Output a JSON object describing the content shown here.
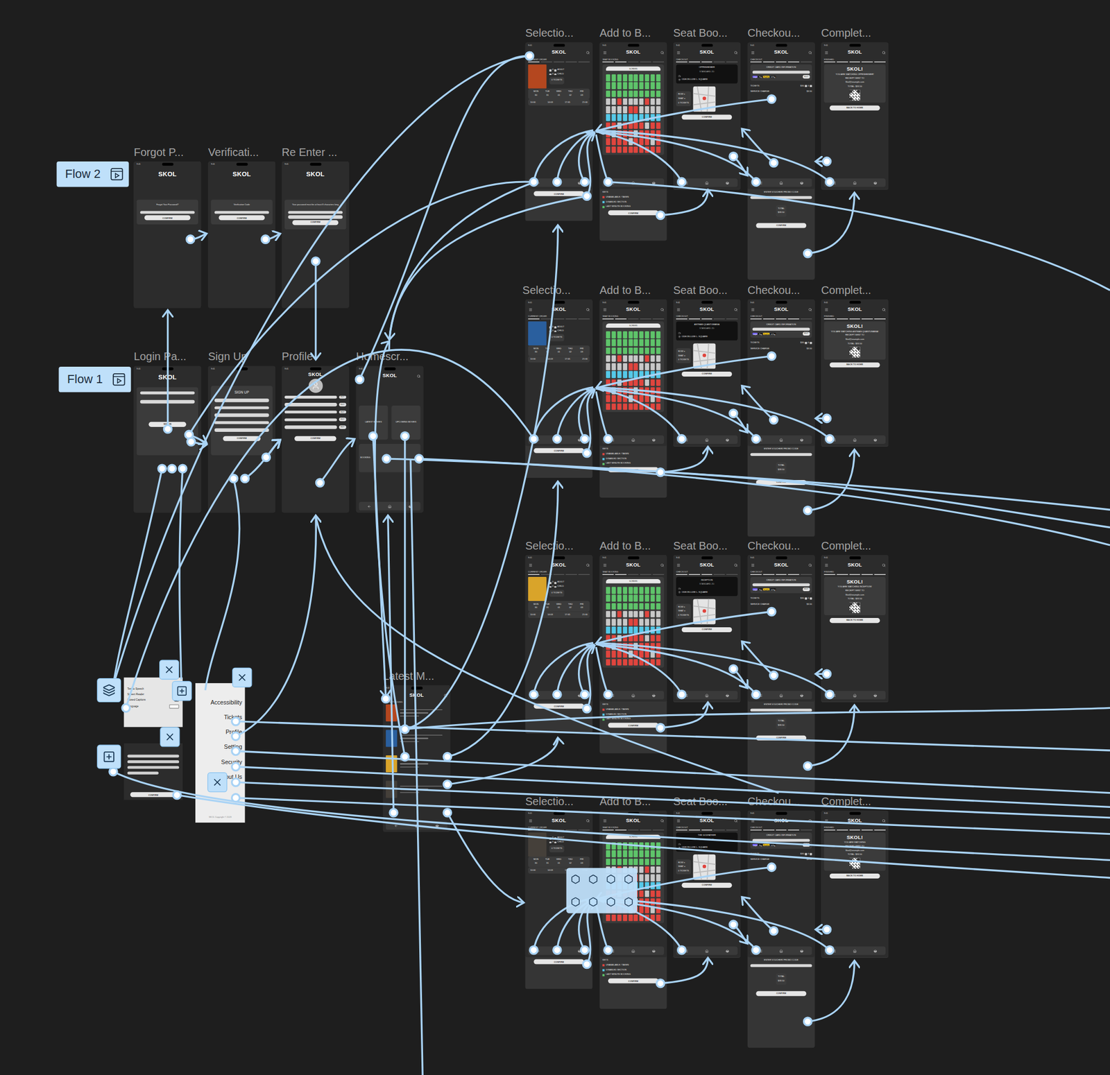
{
  "flows": [
    {
      "label": "Flow 2"
    },
    {
      "label": "Flow 1"
    }
  ],
  "brand": "SKOL",
  "status_time": "9:41",
  "forgot": {
    "title": "Forgot P...",
    "prompt": "Forgot Your Password?",
    "button": "CONFIRM"
  },
  "verification": {
    "title": "Verificati...",
    "prompt": "Verification Code",
    "button": "CONFIRM"
  },
  "reenter": {
    "title": "Re Enter ...",
    "prompt": "Your password must be at least 8 characters long",
    "button": "CONFIRM"
  },
  "login": {
    "title": "Login Pa...",
    "button": "SIGN IN"
  },
  "signup": {
    "title": "Sign Up",
    "heading": "SIGN UP",
    "button": "CONFIRM"
  },
  "profile": {
    "title": "Profile",
    "rows": [
      "EDIT",
      "EDIT",
      "EDIT",
      "EDIT",
      "EDIT"
    ],
    "button": "CONFIRM"
  },
  "home": {
    "title": "Homescr...",
    "tiles": [
      "LATEST MOVIES",
      "UPCOMING MOVIES"
    ],
    "booking": "BOOKING"
  },
  "latest": {
    "title": "Latest M...",
    "heading": "LATEST MOVIES",
    "items": [
      {
        "kind": "movie"
      },
      {
        "kind": "movie"
      },
      {
        "kind": "movie"
      },
      {
        "kind": "movie"
      }
    ]
  },
  "booking": {
    "titles": [
      "Selectio...",
      "Add to B...",
      "Seat Boo...",
      "Checkou...",
      "Complet..."
    ],
    "rows": [
      {
        "movie": "OPPENHEIMER",
        "watching": "YOU ARE WATCHING OPPENHEIMER!"
      },
      {
        "movie": "ANTMAN QUANTUMANIA",
        "watching": "YOU ARE WATCHING ANTMAN QUANTUMANIA!"
      },
      {
        "movie": "INCEPTION",
        "watching": "YOU ARE WATCHING INCEPTION!"
      },
      {
        "movie": "THE GODFATHER",
        "watching": "YOU ARE WATCHING"
      }
    ],
    "selection": {
      "label": "CURRENT ORDER",
      "steps": [
        true,
        false,
        false,
        false,
        false
      ],
      "tickets": [
        {
          "count": "0",
          "label": "ADULT"
        },
        {
          "count": "0",
          "label": "CHILD"
        }
      ],
      "total": "0 TICKETS",
      "days": [
        {
          "day": "MON",
          "date": "30"
        },
        {
          "day": "TUE",
          "date": "31"
        },
        {
          "day": "WED",
          "date": "01"
        },
        {
          "day": "THU",
          "date": "02"
        },
        {
          "day": "FRI",
          "date": "03"
        }
      ],
      "times": [
        "10:00",
        "14:03",
        "17:45",
        "21:00"
      ],
      "button": "CONFIRM"
    },
    "seats": {
      "label": "SEAT BOOKING",
      "steps": [
        true,
        true,
        false,
        false,
        false
      ],
      "screen": "SCREEN",
      "keys": "KEYS",
      "legend": [
        {
          "label": "UNAVAILABLE / TAKEN",
          "color": "#e0453e"
        },
        {
          "label": "DISABLED SECTION",
          "color": "#55c9e8"
        },
        {
          "label": "LAST MINUTE BOOKING",
          "color": "#5ec46a"
        }
      ],
      "map": [
        [
          "last",
          "last",
          "last",
          "last",
          "last",
          "last",
          "last",
          "last",
          "last",
          "last"
        ],
        [
          "last",
          "last",
          "last",
          "last",
          "last",
          "last",
          "last",
          "last",
          "last",
          "last"
        ],
        [
          "last",
          "last",
          "last",
          "last",
          "last",
          "last",
          "last",
          "last",
          "last",
          "last"
        ],
        [
          "free",
          "free",
          "taken",
          "free",
          "free",
          "free",
          "free",
          "taken",
          "free",
          "free"
        ],
        [
          "free",
          "free",
          "free",
          "free",
          "taken",
          "taken",
          "free",
          "free",
          "free",
          "free"
        ],
        [
          "disabled",
          "disabled",
          "disabled",
          "disabled",
          "disabled",
          "disabled",
          "disabled",
          "disabled",
          "disabled",
          "disabled"
        ],
        [
          "taken",
          "taken",
          "free",
          "taken",
          "taken",
          "taken",
          "taken",
          "free",
          "taken",
          "taken"
        ],
        [
          "taken",
          "free",
          "taken",
          "taken",
          "taken",
          "free",
          "taken",
          "taken",
          "taken",
          "taken"
        ],
        [
          "taken",
          "taken",
          "taken",
          "taken",
          "free",
          "taken",
          "taken",
          "taken",
          "free",
          "taken"
        ],
        [
          "taken",
          "taken",
          "taken",
          "taken",
          "taken",
          "taken",
          "taken",
          "taken",
          "taken",
          "taken"
        ]
      ],
      "button": "CONFIRM"
    },
    "summary": {
      "label": "CHECKOUT",
      "steps": [
        true,
        true,
        true,
        false,
        false
      ],
      "format": "STANDARD 2D",
      "cinema": "ODEON LUXE L. SQUARE",
      "row": "ROW x",
      "seat": "SEAT x",
      "tickets": "0 TICKETS",
      "button": "CONFIRM"
    },
    "checkout": {
      "label": "CHECKOUT",
      "steps": [
        true,
        true,
        true,
        true,
        false
      ],
      "card": "CREDIT CARD INFORMATION",
      "edit": "EDIT",
      "pay": [
        {
          "label": "stripe",
          "color": "#6b5bf5"
        },
        {
          "label": "Pay",
          "color": "#111111"
        },
        {
          "label": "PayPal",
          "color": "#f5c518"
        },
        {
          "label": "G Pay",
          "color": "#111111"
        }
      ],
      "lines": [
        {
          "label": "TICKETS",
          "value": "$30",
          "qty": "0"
        },
        {
          "label": "SERVICE CHARGE",
          "value": "$3.50",
          "qty": ""
        }
      ],
      "voucher": "ENTER VOUCHER/ PROMO CODE",
      "total_label": "TOTAL",
      "total": "$33.50",
      "button": "CONFIRM"
    },
    "complete": {
      "label": "FINISHED",
      "steps": [
        true,
        true,
        true,
        true,
        true
      ],
      "heading": "SKOL!",
      "receipt": "RECEIPT SENT TO",
      "email": "Skol@example.com",
      "total": "TOTAL: $33.50",
      "button": "BACK TO HOME"
    }
  },
  "menu": {
    "items": [
      "Accessibility",
      "Tickets",
      "Profile",
      "Setting",
      "Security",
      "About Us"
    ],
    "footer": "SKOL Copyright © 2023",
    "accessibility": [
      {
        "label": "Text to Speech",
        "kind": "toggle",
        "on": false
      },
      {
        "label": "Screen Reader",
        "kind": "toggle",
        "on": true
      },
      {
        "label": "Closed Captions",
        "kind": "toggle",
        "on": true
      },
      {
        "label": "Language",
        "kind": "select",
        "on": false
      }
    ],
    "form_button": "CONFIRM"
  }
}
